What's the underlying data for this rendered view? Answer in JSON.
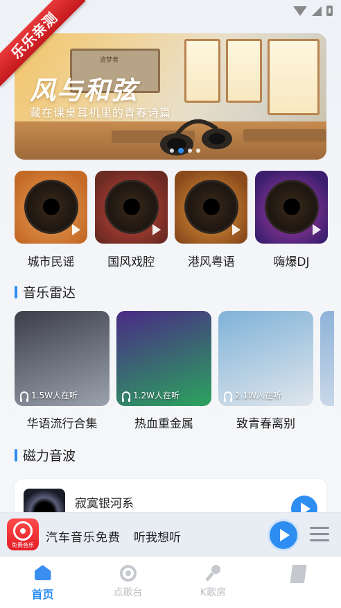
{
  "ribbon": {
    "text": "乐乐亲测"
  },
  "banner": {
    "title": "风与和弦",
    "subtitle": "藏在课桌耳机里的青春诗篇",
    "board_text": "追梦者",
    "active_dot": 1,
    "dot_count": 4
  },
  "categories": [
    {
      "label": "城市民谣",
      "colors": [
        "#c46a26",
        "#e8a05a"
      ]
    },
    {
      "label": "国风戏腔",
      "colors": [
        "#6b2a22",
        "#c6473b"
      ]
    },
    {
      "label": "港风粤语",
      "colors": [
        "#8a4a1c",
        "#e39a3c"
      ]
    },
    {
      "label": "嗨爆DJ",
      "colors": [
        "#3b1f6e",
        "#b03fa6"
      ]
    }
  ],
  "sections": {
    "radar_title": "音乐雷达",
    "magnetic_title": "磁力音波"
  },
  "radar": [
    {
      "title": "华语流行合集",
      "listeners": "1.5W人在听",
      "colors": [
        "#3c3e4a",
        "#9aa2ad"
      ]
    },
    {
      "title": "热血重金属",
      "listeners": "1.2W人在听",
      "colors": [
        "#4a2a86",
        "#2ba45e"
      ]
    },
    {
      "title": "致青春离别",
      "listeners": "2.1W人在听",
      "colors": [
        "#7fb2d8",
        "#e0e6ec"
      ]
    }
  ],
  "magnetic": [
    {
      "title": "寂寞银河系"
    }
  ],
  "player": {
    "app_label": "免费音乐",
    "title": "汽车音乐免费",
    "subtitle": "听我想听"
  },
  "tabs": [
    {
      "label": "首页",
      "icon": "home-icon",
      "active": true
    },
    {
      "label": "点歌台",
      "icon": "disc-icon",
      "active": false
    },
    {
      "label": "K歌房",
      "icon": "mic-icon",
      "active": false
    },
    {
      "label": "",
      "icon": "book-icon",
      "active": false
    }
  ],
  "colors": {
    "accent": "#2d8df0",
    "ribbon": "#d8262a"
  }
}
